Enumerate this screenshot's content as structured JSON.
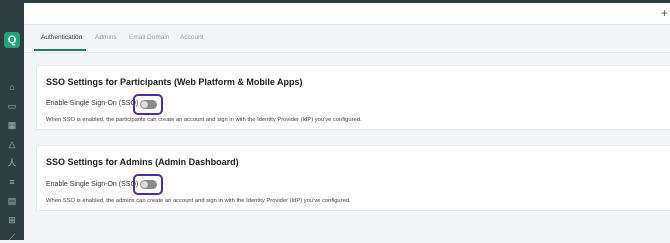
{
  "app": {
    "logo_letter": "Q"
  },
  "header": {
    "add_icon": "+"
  },
  "sidebar": {
    "icons": [
      "home-icon",
      "monitor-icon",
      "schedule-icon",
      "hierarchy-icon",
      "person-icon",
      "list-icon",
      "document-icon",
      "grid-icon",
      "chart-icon"
    ]
  },
  "tabs": [
    {
      "label": "Authentication",
      "active": true
    },
    {
      "label": "Admins",
      "active": false
    },
    {
      "label": "Email Domain",
      "active": false
    },
    {
      "label": "Account",
      "active": false
    }
  ],
  "participants": {
    "title": "SSO Settings for Participants (Web Platform & Mobile Apps)",
    "toggle_label": "Enable Single Sign-On (SSO)",
    "enabled": false,
    "description": "When SSO is enabled, the participants can create an account and sign in with the Identity Provider (IdP) you've configured."
  },
  "admins": {
    "title": "SSO Settings for Admins (Admin Dashboard)",
    "toggle_label": "Enable Single Sign-On (SSO)",
    "enabled": false,
    "description": "When SSO is enabled, the admins can create an account and sign in with the Identity Provider (IdP) you've configured."
  },
  "colors": {
    "accent": "#1e7e6a",
    "highlight": "#4b2fa1",
    "sidebar": "#2e3d3e"
  }
}
